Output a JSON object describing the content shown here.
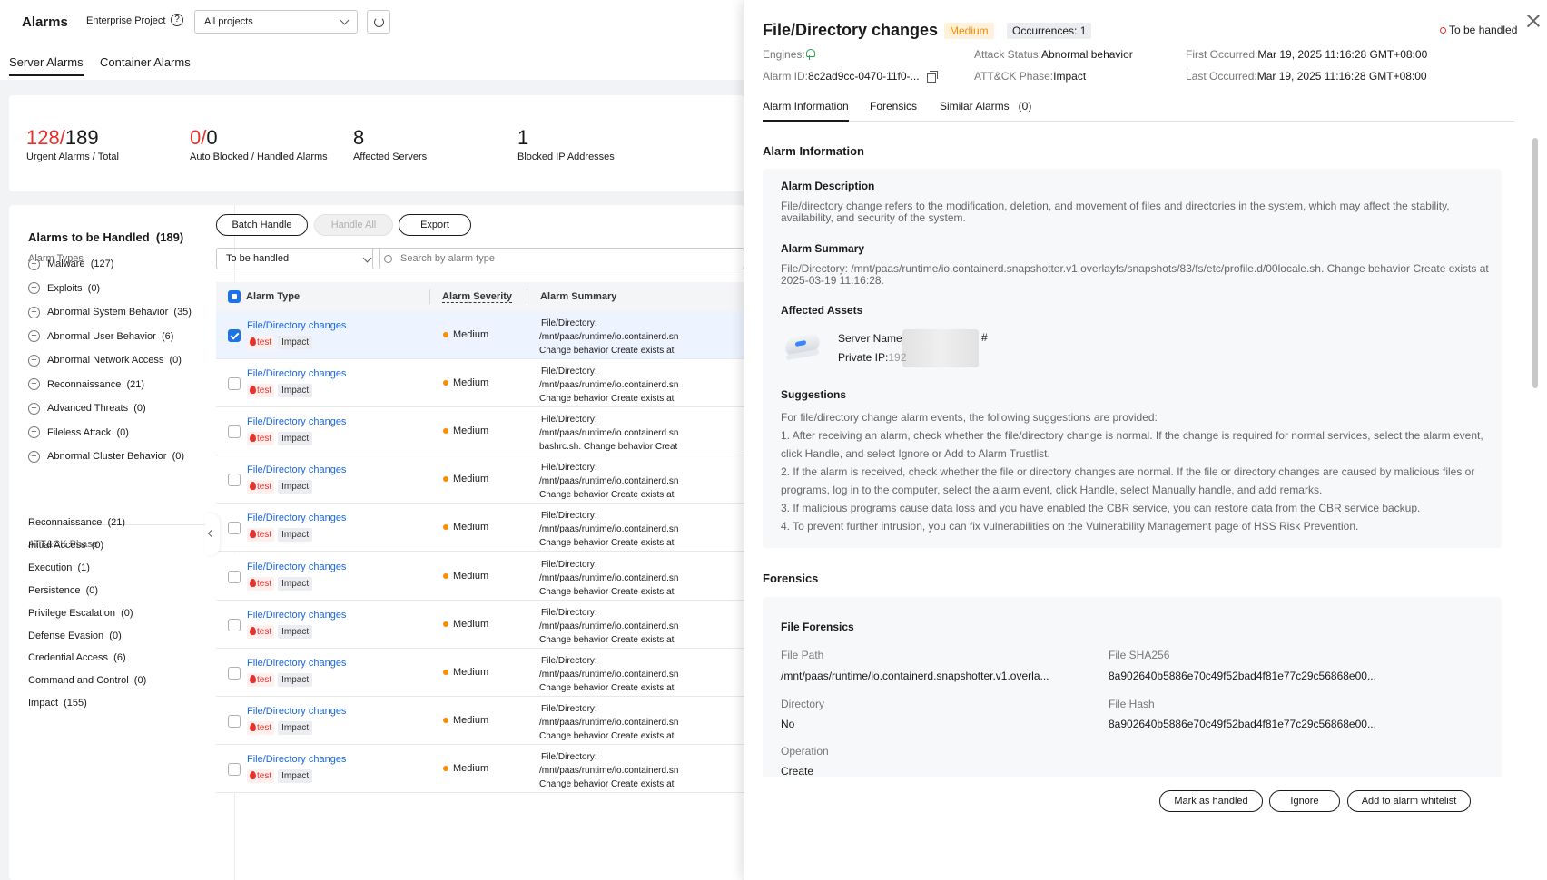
{
  "header": {
    "title": "Alarms",
    "enterprise_project_label": "Enterprise Project",
    "help_glyph": "?",
    "project_select": "All projects",
    "refresh_icon": "refresh-icon"
  },
  "tabs": [
    {
      "label": "Server Alarms",
      "active": true
    },
    {
      "label": "Container Alarms",
      "active": false
    }
  ],
  "stats": {
    "urgent": "128",
    "total": "189",
    "urgent_label": "Urgent Alarms",
    "total_label": "Total",
    "auto_blocked": "0",
    "handled": "0",
    "blocked_label": "Auto Blocked",
    "handled_label": "Handled Alarms",
    "separator": "/",
    "label_separator": " / ",
    "affected_servers": "8",
    "affected_servers_label": "Affected Servers",
    "blocked_ips": "1",
    "blocked_ips_label": "Blocked IP Addresses"
  },
  "sidebar": {
    "title": "Alarms to be Handled",
    "title_count": "(189)",
    "alarm_types_label": "Alarm Types",
    "plus_glyph": "+",
    "alarm_types": [
      {
        "label": "Malware",
        "count": "(127)"
      },
      {
        "label": "Exploits",
        "count": "(0)"
      },
      {
        "label": "Abnormal System Behavior",
        "count": "(35)"
      },
      {
        "label": "Abnormal User Behavior",
        "count": "(6)"
      },
      {
        "label": "Abnormal Network Access",
        "count": "(0)"
      },
      {
        "label": "Reconnaissance",
        "count": "(21)"
      },
      {
        "label": "Advanced Threats",
        "count": "(0)"
      },
      {
        "label": "Fileless Attack",
        "count": "(0)"
      },
      {
        "label": "Abnormal Cluster Behavior",
        "count": "(0)"
      }
    ],
    "phase_label": "ATT&CK Phase",
    "phases": [
      {
        "label": "Reconnaissance",
        "count": "(21)"
      },
      {
        "label": "Initial Access",
        "count": "(0)"
      },
      {
        "label": "Execution",
        "count": "(1)"
      },
      {
        "label": "Persistence",
        "count": "(0)"
      },
      {
        "label": "Privilege Escalation",
        "count": "(0)"
      },
      {
        "label": "Defense Evasion",
        "count": "(0)"
      },
      {
        "label": "Credential Access",
        "count": "(6)"
      },
      {
        "label": "Command and Control",
        "count": "(0)"
      },
      {
        "label": "Impact",
        "count": "(155)"
      }
    ]
  },
  "toolbar": {
    "batch_handle": "Batch Handle",
    "handle_all": "Handle All",
    "export": "Export",
    "status_filter": "To be handled",
    "search_placeholder": "Search by alarm type"
  },
  "table": {
    "columns": [
      "Alarm Type",
      "Alarm Severity",
      "Alarm Summary"
    ],
    "rows": [
      {
        "type": "File/Directory changes",
        "tag1": "test",
        "tag2": "Impact",
        "severity": "Medium",
        "summary": [
          "File/Directory:",
          "/mnt/paas/runtime/io.containerd.sn",
          "Change behavior Create exists at"
        ],
        "checked": true
      },
      {
        "type": "File/Directory changes",
        "tag1": "test",
        "tag2": "Impact",
        "severity": "Medium",
        "summary": [
          "File/Directory:",
          "/mnt/paas/runtime/io.containerd.sn",
          "Change behavior Create exists at"
        ],
        "checked": false
      },
      {
        "type": "File/Directory changes",
        "tag1": "test",
        "tag2": "Impact",
        "severity": "Medium",
        "summary": [
          "File/Directory:",
          "/mnt/paas/runtime/io.containerd.sn",
          "bashrc.sh. Change behavior Creat"
        ],
        "checked": false
      },
      {
        "type": "File/Directory changes",
        "tag1": "test",
        "tag2": "Impact",
        "severity": "Medium",
        "summary": [
          "File/Directory:",
          "/mnt/paas/runtime/io.containerd.sn",
          "Change behavior Create exists at"
        ],
        "checked": false
      },
      {
        "type": "File/Directory changes",
        "tag1": "test",
        "tag2": "Impact",
        "severity": "Medium",
        "summary": [
          "File/Directory:",
          "/mnt/paas/runtime/io.containerd.sn",
          "Change behavior Create exists at"
        ],
        "checked": false
      },
      {
        "type": "File/Directory changes",
        "tag1": "test",
        "tag2": "Impact",
        "severity": "Medium",
        "summary": [
          "File/Directory:",
          "/mnt/paas/runtime/io.containerd.sn",
          "Change behavior Create exists at"
        ],
        "checked": false
      },
      {
        "type": "File/Directory changes",
        "tag1": "test",
        "tag2": "Impact",
        "severity": "Medium",
        "summary": [
          "File/Directory:",
          "/mnt/paas/runtime/io.containerd.sn",
          "Change behavior Create exists at"
        ],
        "checked": false
      },
      {
        "type": "File/Directory changes",
        "tag1": "test",
        "tag2": "Impact",
        "severity": "Medium",
        "summary": [
          "File/Directory:",
          "/mnt/paas/runtime/io.containerd.sn",
          "Change behavior Create exists at"
        ],
        "checked": false
      },
      {
        "type": "File/Directory changes",
        "tag1": "test",
        "tag2": "Impact",
        "severity": "Medium",
        "summary": [
          "File/Directory:",
          "/mnt/paas/runtime/io.containerd.sn",
          "Change behavior Create exists at"
        ],
        "checked": false
      },
      {
        "type": "File/Directory changes",
        "tag1": "test",
        "tag2": "Impact",
        "severity": "Medium",
        "summary": [
          "File/Directory:",
          "/mnt/paas/runtime/io.containerd.sn",
          "Change behavior Create exists at"
        ],
        "checked": false
      }
    ]
  },
  "drawer": {
    "title": "File/Directory changes",
    "severity": "Medium",
    "occurrences": "Occurrences: 1",
    "status": "To be handled",
    "meta": {
      "engines_label": "Engines:",
      "engine_icon": "pin-icon",
      "alarm_id_label": "Alarm ID:",
      "alarm_id": "8c2ad9cc-0470-11f0-...",
      "attack_status_label": "Attack Status:",
      "attack_status": "Abnormal behavior",
      "phase_label": "ATT&CK Phase:",
      "phase": "Impact",
      "first_label": "First Occurred:",
      "first": "Mar 19, 2025 11:16:28 GMT+08:00",
      "last_label": "Last Occurred:",
      "last": "Mar 19, 2025 11:16:28 GMT+08:00"
    },
    "tabs": [
      "Alarm Information",
      "Forensics",
      "Similar Alarms   (0)"
    ],
    "alarm_info": {
      "section_title": "Alarm Information",
      "desc_title": "Alarm Description",
      "desc": "File/directory change refers to the modification, deletion, and movement of files and directories in the system, which may affect the stability, availability, and security of the system.",
      "summary_title": "Alarm Summary",
      "summary": "File/Directory: /mnt/paas/runtime/io.containerd.snapshotter.v1.overlayfs/snapshots/83/fs/etc/profile.d/00locale.sh. Change behavior Create exists at 2025-03-19 11:16:28.",
      "assets_title": "Affected Assets",
      "server_name_label": "Server Name",
      "server_name_suffix": "#",
      "private_ip_label": "Private IP:",
      "private_ip_prefix": "192",
      "suggestions_title": "Suggestions",
      "suggestions": [
        "For file/directory change alarm events, the following suggestions are provided:",
        "1. After receiving an alarm, check whether the file/directory change is normal. If the change is required for normal services, select the alarm event, click Handle, and select Ignore or Add to Alarm Trustlist.",
        "2. If the alarm is received, check whether the file or directory changes are normal. If the file or directory changes are caused by malicious files or programs, log in to the computer, select the alarm event, click Handle, select Manually handle, and add remarks.",
        "3. If malicious programs cause data loss and you have enabled the CBR service, you can restore data from the CBR service backup.",
        "4. To prevent further intrusion, you can fix vulnerabilities on the Vulnerability Management page of HSS Risk Prevention."
      ]
    },
    "forensics": {
      "section_title": "Forensics",
      "file_title": "File Forensics",
      "file_path_label": "File Path",
      "file_path": "/mnt/paas/runtime/io.containerd.snapshotter.v1.overla...",
      "sha_label": "File SHA256",
      "sha": "8a902640b5886e70c49f52bad4f81e77c29c56868e00...",
      "dir_label": "Directory",
      "dir": "No",
      "hash_label": "File Hash",
      "hash": "8a902640b5886e70c49f52bad4f81e77c29c56868e00...",
      "op_label": "Operation",
      "op": "Create"
    },
    "footer": {
      "mark_handled": "Mark as handled",
      "ignore": "Ignore",
      "whitelist": "Add to alarm whitelist"
    }
  },
  "colors": {
    "accent_blue": "#1a73e8",
    "link_blue": "#1a66e0",
    "urgent_red": "#e6312d",
    "medium_orange": "#f98c00"
  }
}
